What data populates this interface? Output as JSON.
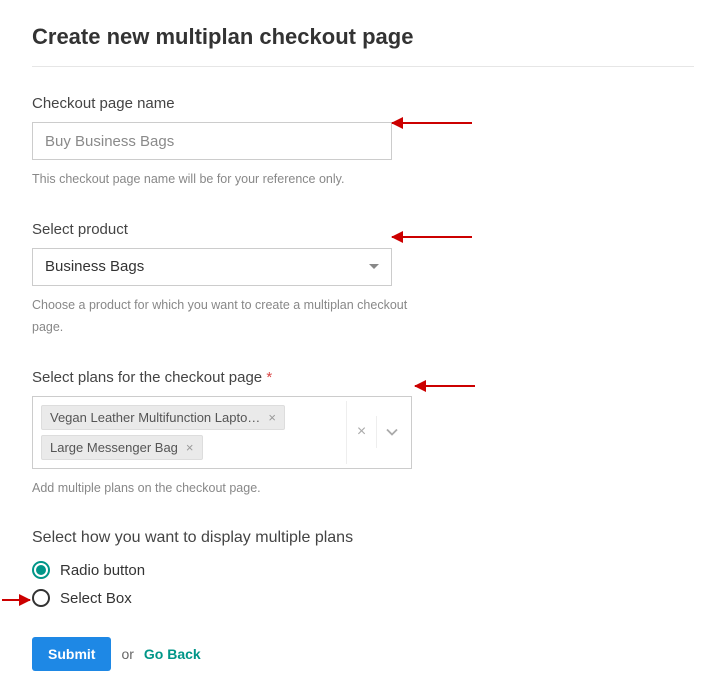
{
  "title": "Create new multiplan checkout page",
  "fields": {
    "name": {
      "label": "Checkout page name",
      "value": "Buy Business Bags",
      "hint": "This checkout page name will be for your reference only."
    },
    "product": {
      "label": "Select product",
      "value": "Business Bags",
      "hint": "Choose a product for which you want to create a multiplan checkout page."
    },
    "plans": {
      "label": "Select plans for the checkout page",
      "required_marker": "*",
      "tags": [
        "Vegan Leather Multifunction Lapto…",
        "Large Messenger Bag"
      ],
      "hint": "Add multiple plans on the checkout page."
    },
    "display": {
      "label": "Select how you want to display multiple plans",
      "options": [
        "Radio button",
        "Select Box"
      ],
      "selected": "Radio button"
    }
  },
  "actions": {
    "submit": "Submit",
    "or": "or",
    "back": "Go Back"
  }
}
